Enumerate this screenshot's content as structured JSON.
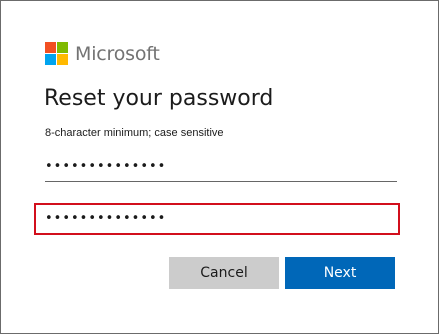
{
  "brand": {
    "name": "Microsoft",
    "logo_colors": [
      "#f25022",
      "#7fba00",
      "#00a4ef",
      "#ffb900"
    ]
  },
  "page": {
    "title": "Reset your password",
    "hint": "8-character minimum; case sensitive"
  },
  "fields": {
    "new_password": "••••••••••••••",
    "confirm_password": "••••••••••••••"
  },
  "buttons": {
    "cancel": "Cancel",
    "next": "Next"
  },
  "colors": {
    "accent": "#0067b8",
    "highlight": "#d20f1c",
    "secondary_button": "#cccccc"
  }
}
